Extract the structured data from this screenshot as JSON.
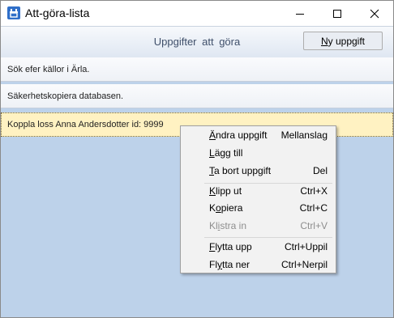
{
  "window": {
    "title": "Att-göra-lista",
    "icon": "app-icon",
    "controls": [
      "minimize-icon",
      "maximize-icon",
      "close-icon"
    ]
  },
  "toolbar": {
    "title": "Uppgifter att göra",
    "new_button_label": "Ny uppgift"
  },
  "tasks": [
    {
      "text": "Sök efer källor i Ärla."
    },
    {
      "text": "Säkerhetskopiera databasen."
    },
    {
      "text": "Koppla loss Anna Andersdotter id: 9999",
      "selected": true
    }
  ],
  "context_menu": {
    "items": [
      {
        "label": "Ändra uppgift",
        "shortcut": "Mellanslag",
        "enabled": true
      },
      {
        "label": "Lägg till",
        "shortcut": "",
        "enabled": true
      },
      {
        "label": "Ta bort uppgift",
        "shortcut": "Del",
        "enabled": true
      },
      {
        "label": "Klipp ut",
        "shortcut": "Ctrl+X",
        "enabled": true
      },
      {
        "label": "Kopiera",
        "shortcut": "Ctrl+C",
        "enabled": true
      },
      {
        "label": "Klistra in",
        "shortcut": "Ctrl+V",
        "enabled": false
      },
      {
        "label": "Flytta upp",
        "shortcut": "Ctrl+Uppil",
        "enabled": true
      },
      {
        "label": "Flytta ner",
        "shortcut": "Ctrl+Nerpil",
        "enabled": true
      }
    ]
  },
  "colors": {
    "client_background": "#bdd2ea",
    "selected_row": "#fff2c2",
    "app_icon": "#2f6fc9"
  }
}
